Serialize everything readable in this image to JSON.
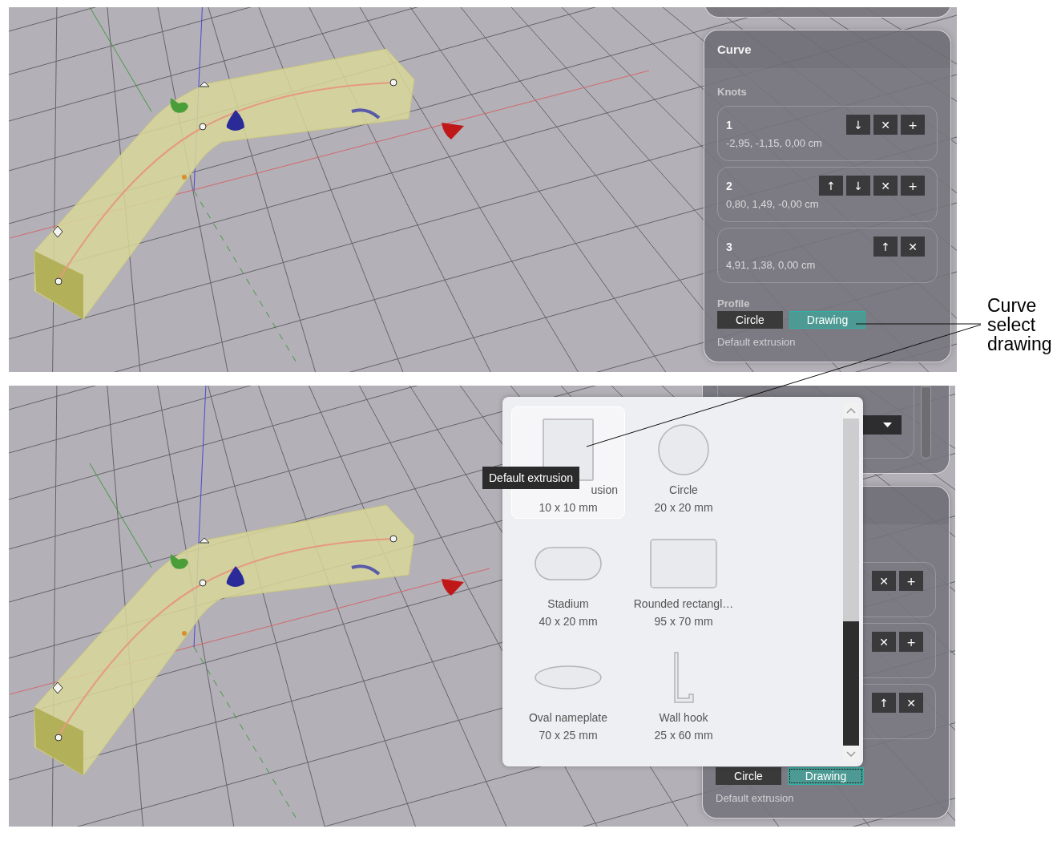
{
  "top_screen": {
    "curve_panel": {
      "title": "Curve",
      "knots_label": "Knots",
      "knots": [
        {
          "number": "1",
          "position": "-2,95, -1,15, 0,00 cm",
          "actions": [
            "↓",
            "✕",
            "+"
          ]
        },
        {
          "number": "2",
          "position": "0,80, 1,49, -0,00 cm",
          "actions": [
            "↑",
            "↓",
            "✕",
            "+"
          ]
        },
        {
          "number": "3",
          "position": "4,91, 1,38, 0,00 cm",
          "actions": [
            "↑",
            "✕"
          ]
        }
      ],
      "profile_label": "Profile",
      "profile_options": [
        {
          "label": "Circle",
          "selected": false,
          "focused": false
        },
        {
          "label": "Drawing",
          "selected": true,
          "focused": false
        }
      ],
      "profile_name": "Default extrusion"
    }
  },
  "bottom_screen": {
    "curve_panel": {
      "knots": [
        {
          "actions": [
            "✕",
            "+"
          ]
        },
        {
          "actions": [
            "✕",
            "+"
          ]
        },
        {
          "actions": [
            "↑",
            "✕"
          ]
        }
      ],
      "profile_options": [
        {
          "label": "Circle",
          "selected": false,
          "focused": false
        },
        {
          "label": "Drawing",
          "selected": true,
          "focused": true
        }
      ],
      "profile_name": "Default extrusion"
    },
    "profile_popup": {
      "tiles": [
        {
          "kind": "square",
          "name": "usion",
          "size": "10 x 10 mm",
          "selected": true
        },
        {
          "kind": "circle",
          "name": "Circle",
          "size": "20 x 20 mm",
          "selected": false
        },
        {
          "kind": "stadium",
          "name": "Stadium",
          "size": "40 x 20 mm",
          "selected": false
        },
        {
          "kind": "rounded-rectangle",
          "name": "Rounded rectangl…",
          "size": "95 x 70 mm",
          "selected": false
        },
        {
          "kind": "ellipse",
          "name": "Oval nameplate",
          "size": "70 x 25 mm",
          "selected": false
        },
        {
          "kind": "hook",
          "name": "Wall hook",
          "size": "25 x 60 mm",
          "selected": false
        }
      ],
      "tooltip": "Default extrusion"
    }
  },
  "callout": {
    "text": "Curve select drawing"
  }
}
